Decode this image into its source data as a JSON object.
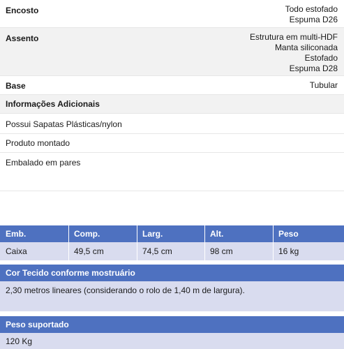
{
  "specs": [
    {
      "label": "Encosto",
      "values": [
        "Todo estofado",
        "Espuma D26"
      ]
    },
    {
      "label": "Assento",
      "values": [
        "Estrutura em  multi-HDF",
        "Manta siliconada",
        "Estofado",
        "Espuma  D28"
      ]
    },
    {
      "label": "Base",
      "values": [
        "Tubular"
      ]
    }
  ],
  "info_title": "Informações Adicionais",
  "info_items": [
    "Possui Sapatas Plásticas/nylon",
    "Produto montado",
    "Embalado em pares"
  ],
  "dims_table": {
    "headers": [
      "Emb.",
      "Comp.",
      "Larg.",
      "Alt.",
      "Peso"
    ],
    "row": [
      "Caixa",
      "49,5 cm",
      "74,5 cm",
      "98 cm",
      "16 kg"
    ]
  },
  "fabric": {
    "title": "Cor Tecido conforme mostruário",
    "text": "2,30 metros lineares (considerando o rolo de 1,40 m de largura)."
  },
  "weight": {
    "title": "Peso suportado",
    "value": "120 Kg"
  }
}
